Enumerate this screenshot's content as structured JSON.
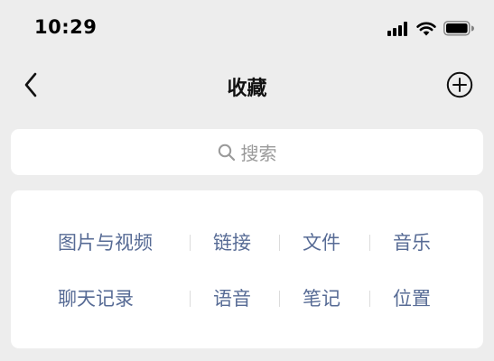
{
  "status_bar": {
    "time": "10:29",
    "icons": [
      "signal-icon",
      "wifi-icon",
      "battery-icon"
    ]
  },
  "nav": {
    "title": "收藏",
    "back_icon": "chevron-left-icon",
    "add_icon": "plus-circle-icon"
  },
  "search": {
    "placeholder": "搜索",
    "icon": "search-icon"
  },
  "categories": {
    "row1": [
      "图片与视频",
      "链接",
      "文件",
      "音乐"
    ],
    "row2": [
      "聊天记录",
      "语音",
      "笔记",
      "位置"
    ]
  },
  "colors": {
    "background": "#ededed",
    "card": "#ffffff",
    "link_blue": "#576b95",
    "placeholder_gray": "#9a9a9a"
  }
}
